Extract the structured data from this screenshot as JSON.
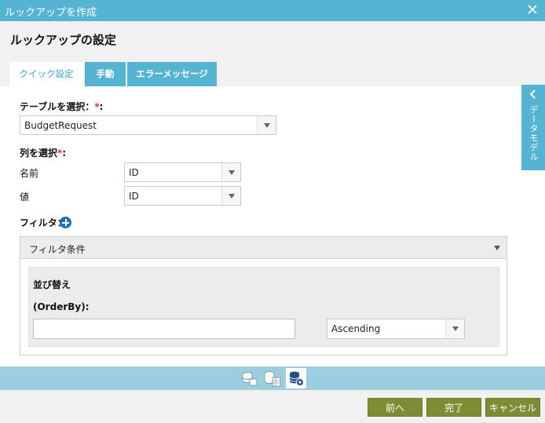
{
  "window": {
    "title": "ルックアップを作成"
  },
  "header": {
    "title": "ルックアップの設定"
  },
  "tabs": [
    {
      "label": "クイック設定",
      "active": true
    },
    {
      "label": "手動",
      "active": false
    },
    {
      "label": "エラーメッセージ",
      "active": false
    }
  ],
  "table_select": {
    "label": "テーブルを選択：",
    "required_mark": "*",
    "colon": ":",
    "value": "BudgetRequest"
  },
  "column_select": {
    "label": "列を選択",
    "required_mark": "*",
    "colon": ":",
    "name_label": "名前",
    "name_value": "ID",
    "value_label": "値",
    "value_value": "ID"
  },
  "filter": {
    "label": "フィルタ：",
    "panel_title": "フィルタ条件"
  },
  "sort": {
    "title": "並び替え",
    "orderby_label": "(OrderBy):",
    "orderby_value": "",
    "direction": "Ascending"
  },
  "side_panel": {
    "label": "データモデル"
  },
  "bottom_tabs": [
    "database-list-icon",
    "database-table-icon",
    "database-settings-icon"
  ],
  "footer": {
    "prev": "前へ",
    "done": "完了",
    "cancel": "キャンセル"
  },
  "colors": {
    "accent": "#55b4d2",
    "button": "#7e8c34",
    "required": "#e03030",
    "add": "#1f6fb4"
  }
}
